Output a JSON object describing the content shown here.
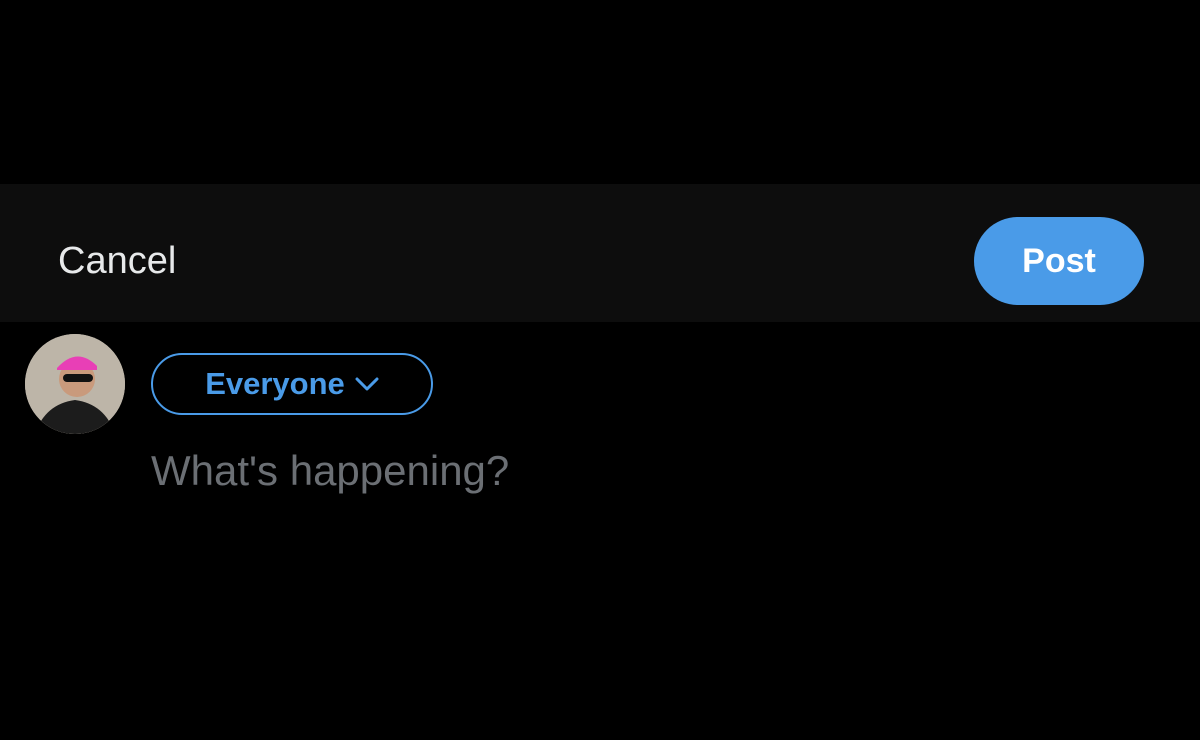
{
  "header": {
    "cancel_label": "Cancel",
    "post_label": "Post"
  },
  "audience": {
    "label": "Everyone",
    "icon": "chevron-down-icon"
  },
  "composer": {
    "placeholder": "What's happening?"
  },
  "colors": {
    "accent": "#4a9be8",
    "background": "#000000",
    "header_background": "#0d0d0d",
    "text": "#e7e9ea"
  }
}
